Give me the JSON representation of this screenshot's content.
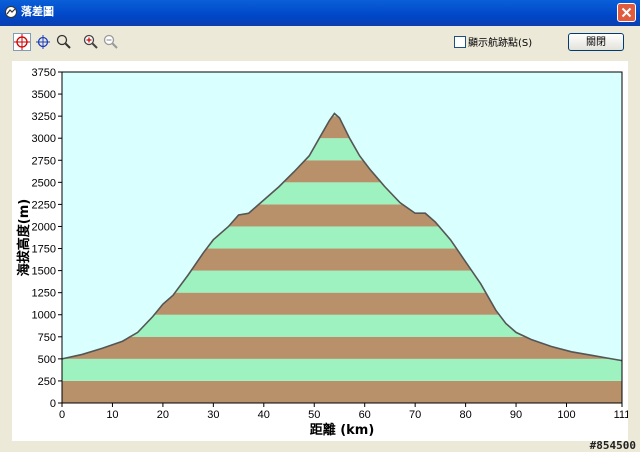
{
  "window": {
    "title": "落差圖",
    "close_icon": "close-icon",
    "app_icon": "profile-app-icon"
  },
  "toolbar": {
    "tools": [
      {
        "name": "crosshair-red-icon",
        "color": "#cc0000"
      },
      {
        "name": "crosshair-blue-icon",
        "color": "#1d3fbf"
      },
      {
        "name": "zoom-window-icon",
        "color": "#333333"
      },
      {
        "name": "zoom-in-icon",
        "color": "#444444"
      },
      {
        "name": "zoom-out-icon",
        "color": "#9a9a9a"
      }
    ],
    "show_nodes_label": "顯示航跡點(S)",
    "show_nodes_checked": false,
    "close_button_label": "關閉"
  },
  "chart_data": {
    "type": "area",
    "xlabel": "距離  (km)",
    "ylabel": "海拔高度(m)",
    "xlim": [
      0,
      111
    ],
    "ylim": [
      0,
      3750
    ],
    "x_ticks": [
      "0",
      "10",
      "20",
      "30",
      "40",
      "50",
      "60",
      "70",
      "80",
      "90",
      "100",
      "111"
    ],
    "y_ticks": [
      "0",
      "250",
      "500",
      "750",
      "1000",
      "1250",
      "1500",
      "1750",
      "2000",
      "2250",
      "2500",
      "2750",
      "3000",
      "3250",
      "3500",
      "3750"
    ],
    "band_height": 250,
    "colors": {
      "background": "#d9ffff",
      "band_dark": "#b8916b",
      "band_light": "#9ef2c0",
      "outline": "#555555"
    },
    "x": [
      0,
      4,
      8,
      12,
      15,
      18,
      20,
      22,
      25,
      28,
      30,
      33,
      35,
      37,
      40,
      43,
      46,
      49,
      51,
      53,
      54,
      55,
      57,
      59,
      61,
      64,
      67,
      70,
      72,
      74,
      77,
      80,
      83,
      86,
      88,
      90,
      93,
      97,
      101,
      105,
      108,
      111
    ],
    "y": [
      500,
      550,
      620,
      700,
      800,
      980,
      1120,
      1220,
      1450,
      1700,
      1850,
      2000,
      2130,
      2150,
      2300,
      2450,
      2620,
      2800,
      3000,
      3200,
      3280,
      3230,
      3000,
      2800,
      2650,
      2450,
      2270,
      2150,
      2150,
      2050,
      1850,
      1600,
      1350,
      1050,
      900,
      800,
      720,
      640,
      580,
      540,
      510,
      480
    ]
  },
  "watermark": "#854500"
}
